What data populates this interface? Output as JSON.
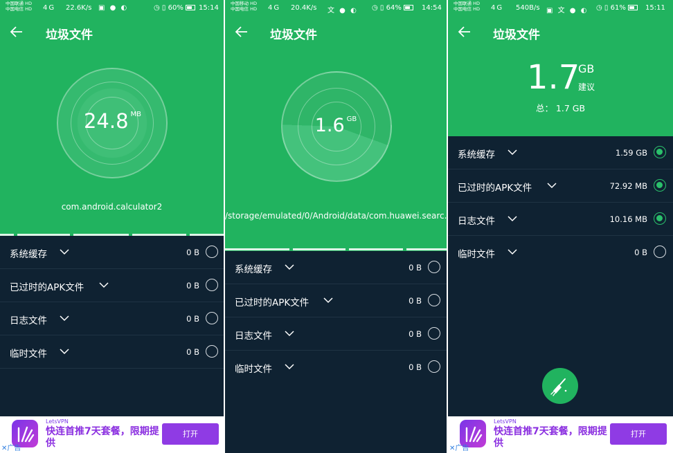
{
  "screens": [
    {
      "status": {
        "carrier1": "中国联通 HD",
        "carrier2": "中国电信 HD",
        "signal": "4G",
        "speed": "22.6K/s",
        "battery": "60%",
        "time": "15:14"
      },
      "title": "垃圾文件",
      "amount": "24.8",
      "unit": "MB",
      "path": "com.android.calculator2",
      "rows": [
        {
          "label": "系统缓存",
          "size": "0 B"
        },
        {
          "label": "已过时的APK文件",
          "size": "0 B"
        },
        {
          "label": "日志文件",
          "size": "0 B"
        },
        {
          "label": "临时文件",
          "size": "0 B"
        }
      ],
      "ad": {
        "brand": "LetsVPN",
        "headline": "快连首推7天套餐，限期提供",
        "button": "打开",
        "tag": "✕广告"
      }
    },
    {
      "status": {
        "carrier1": "中国移动 HD",
        "carrier2": "中国电信 HD",
        "signal": "4G",
        "speed": "20.4K/s",
        "battery": "64%",
        "time": "14:54"
      },
      "title": "垃圾文件",
      "amount": "1.6",
      "unit": "GB",
      "path": "/storage/emulated/0/Android/data/com.huawei.searc...",
      "rows": [
        {
          "label": "系统缓存",
          "size": "0 B"
        },
        {
          "label": "已过时的APK文件",
          "size": "0 B"
        },
        {
          "label": "日志文件",
          "size": "0 B"
        },
        {
          "label": "临时文件",
          "size": "0 B"
        }
      ]
    },
    {
      "status": {
        "carrier1": "中国联通 HD",
        "carrier2": "中国电信 HD",
        "signal": "4G",
        "speed": "540B/s",
        "battery": "61%",
        "time": "15:11"
      },
      "title": "垃圾文件",
      "amount": "1.7",
      "unit": "GB",
      "suggest": "建议",
      "total": "总：  1.7 GB",
      "rows": [
        {
          "label": "系统缓存",
          "size": "1.59 GB",
          "checked": true
        },
        {
          "label": "已过时的APK文件",
          "size": "72.92 MB",
          "checked": true
        },
        {
          "label": "日志文件",
          "size": "10.16 MB",
          "checked": true
        },
        {
          "label": "临时文件",
          "size": "0 B",
          "checked": false
        }
      ],
      "ad": {
        "brand": "LetsVPN",
        "headline": "快连首推7天套餐，限期提供",
        "button": "打开",
        "tag": "✕广告"
      },
      "clean_icon": "broom-icon"
    }
  ],
  "colors": {
    "green": "#21b35f",
    "dark": "#0f2232",
    "accent": "#2bc06b",
    "ad_purple": "#8f3be4"
  }
}
